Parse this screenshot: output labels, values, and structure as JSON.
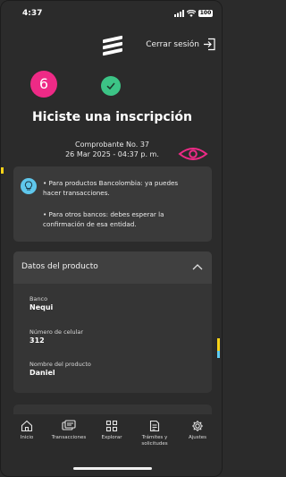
{
  "status_bar": {
    "time": "4:37",
    "battery": "100"
  },
  "header": {
    "logout_label": "Cerrar sesión"
  },
  "success": {
    "badge_number": "6",
    "title": "Hiciste una inscripción",
    "receipt_line": "Comprobante No. 37",
    "date_line": "26 Mar 2025 - 04:37 p. m."
  },
  "info": {
    "bullet_1_line_1": "• Para productos Bancolombia: ya puedes",
    "bullet_1_line_2": "hacer transacciones.",
    "bullet_2_line_1": "• Para otros bancos: debes esperar la",
    "bullet_2_line_2": "confirmación de esa entidad."
  },
  "product": {
    "header": "Datos del producto",
    "fields": [
      {
        "label": "Banco",
        "value": "Nequi"
      },
      {
        "label": "Número de celular",
        "value": "312"
      },
      {
        "label": "Nombre del producto",
        "value": "Daniel"
      }
    ]
  },
  "nav": {
    "items": [
      {
        "label": "Inicio"
      },
      {
        "label": "Transacciones"
      },
      {
        "label": "Explorar"
      },
      {
        "label_line_1": "Trámites y",
        "label_line_2": "solicitudes"
      },
      {
        "label": "Ajustes"
      }
    ]
  },
  "colors": {
    "background": "#2b2b2b",
    "badge_pink": "#ee2a86",
    "success_green": "#3cc486",
    "bulb_blue": "#5fc7ec",
    "accent_yellow": "#f7d218"
  }
}
